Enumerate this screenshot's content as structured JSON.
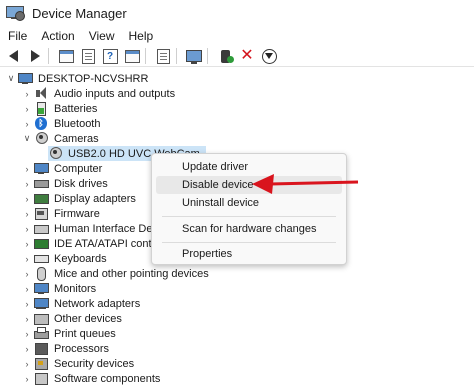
{
  "window": {
    "title": "Device Manager"
  },
  "menu": [
    "File",
    "Action",
    "View",
    "Help"
  ],
  "toolbar": {
    "icons": [
      "back-arrow-icon",
      "forward-arrow-icon",
      "show-hide-console-tree-icon",
      "properties-icon",
      "help-icon",
      "update-driver-icon",
      "monitor-icon",
      "enable-device-icon",
      "uninstall-device-icon",
      "download-icon"
    ]
  },
  "tree": {
    "root": "DESKTOP-NCVSHRR",
    "items": [
      {
        "label": "Audio inputs and outputs",
        "icon": "speaker-icon"
      },
      {
        "label": "Batteries",
        "icon": "battery-icon"
      },
      {
        "label": "Bluetooth",
        "icon": "bluetooth-icon"
      },
      {
        "label": "Cameras",
        "icon": "camera-icon",
        "expanded": true
      },
      {
        "label": "USB2.0 HD UVC WebCam",
        "icon": "webcam-icon",
        "child": true,
        "selected": true
      },
      {
        "label": "Computer",
        "icon": "computer-icon"
      },
      {
        "label": "Disk drives",
        "icon": "disk-drive-icon"
      },
      {
        "label": "Display adapters",
        "icon": "display-adapter-icon"
      },
      {
        "label": "Firmware",
        "icon": "firmware-icon"
      },
      {
        "label": "Human Interface Devices",
        "icon": "hid-icon"
      },
      {
        "label": "IDE ATA/ATAPI controllers",
        "icon": "ide-controller-icon"
      },
      {
        "label": "Keyboards",
        "icon": "keyboard-icon"
      },
      {
        "label": "Mice and other pointing devices",
        "icon": "mouse-icon"
      },
      {
        "label": "Monitors",
        "icon": "monitor-icon"
      },
      {
        "label": "Network adapters",
        "icon": "network-adapter-icon"
      },
      {
        "label": "Other devices",
        "icon": "other-devices-icon"
      },
      {
        "label": "Print queues",
        "icon": "printer-icon"
      },
      {
        "label": "Processors",
        "icon": "processor-icon"
      },
      {
        "label": "Security devices",
        "icon": "security-device-icon"
      },
      {
        "label": "Software components",
        "icon": "software-components-icon"
      }
    ]
  },
  "context_menu": {
    "items": [
      "Update driver",
      "Disable device",
      "Uninstall device",
      "Scan for hardware changes",
      "Properties"
    ],
    "highlighted": "Disable device"
  },
  "colors": {
    "selection": "#cce4f7",
    "arrow": "#d9141d"
  }
}
